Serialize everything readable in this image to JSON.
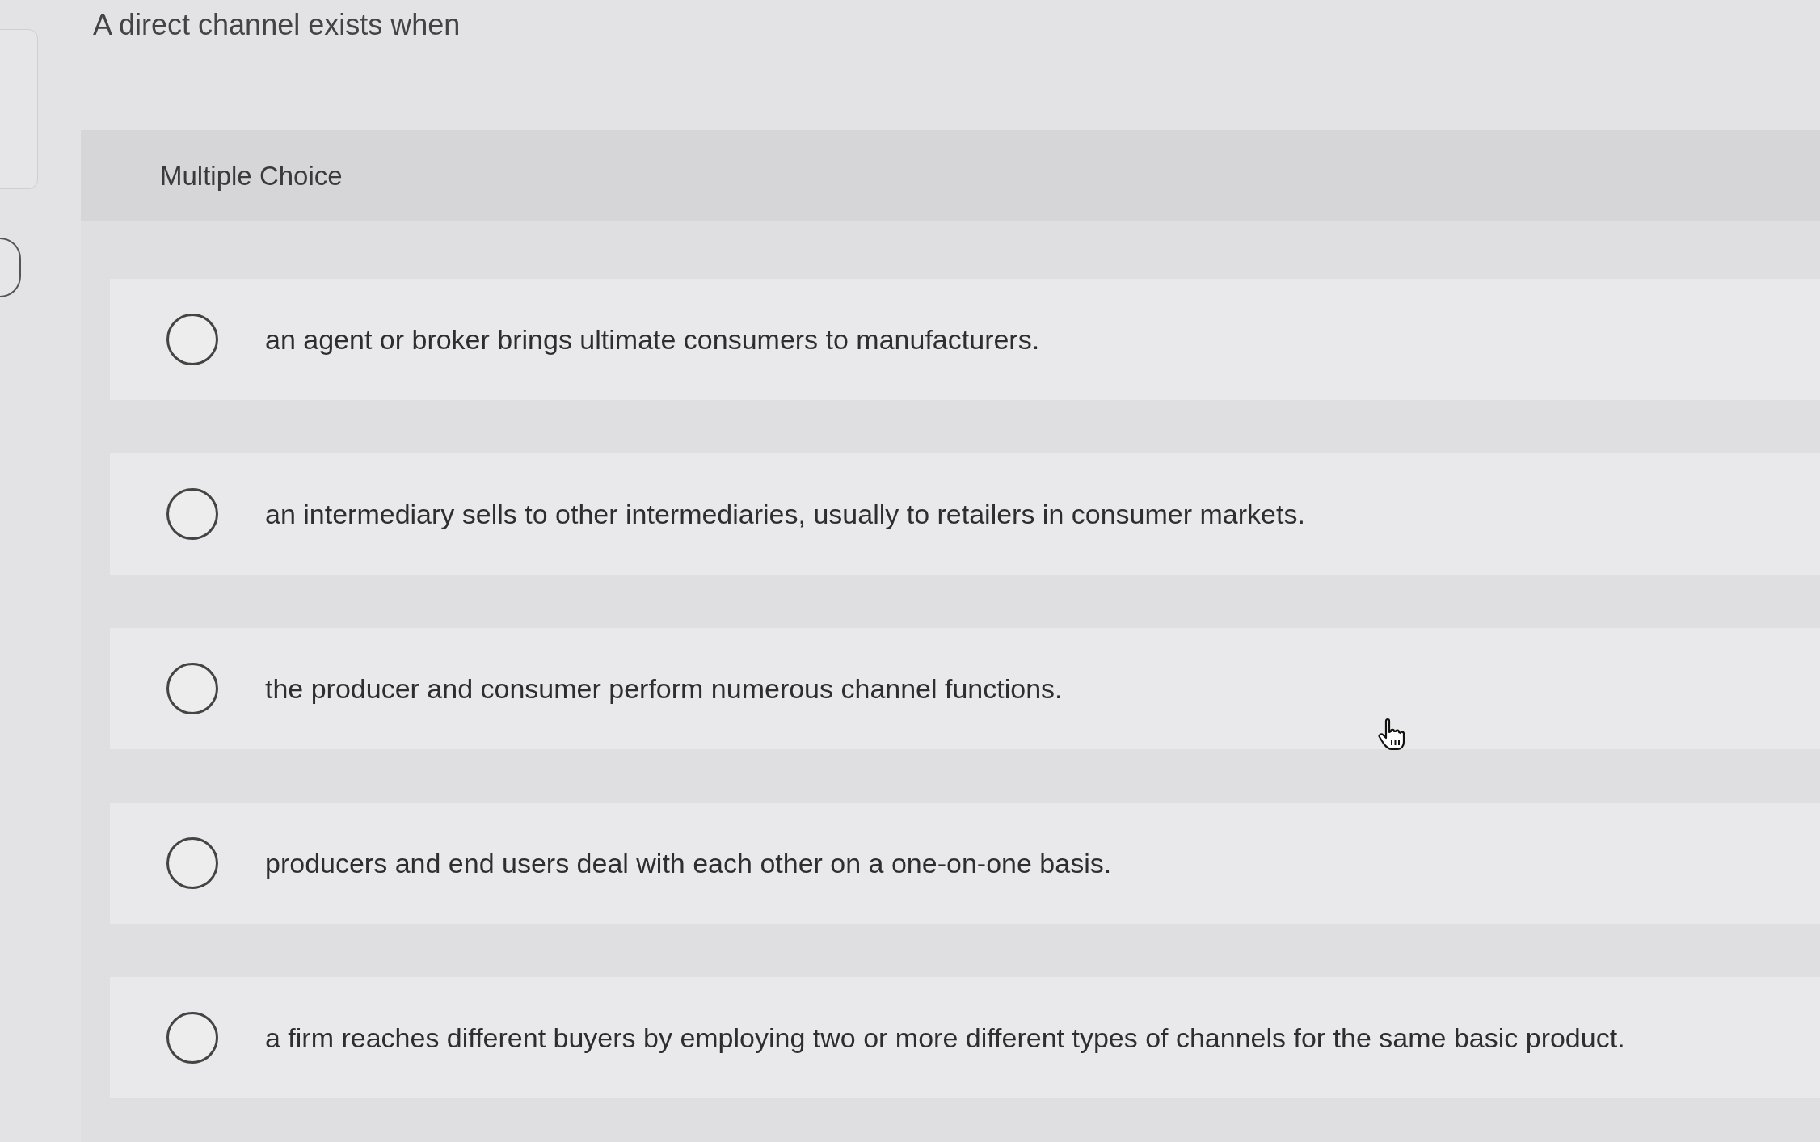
{
  "question": {
    "prompt": "A direct channel exists when"
  },
  "panel": {
    "label": "Multiple Choice"
  },
  "options": [
    {
      "text": "an agent or broker brings ultimate consumers to manufacturers.",
      "selected": false
    },
    {
      "text": "an intermediary sells to other intermediaries, usually to retailers in consumer markets.",
      "selected": false
    },
    {
      "text": "the producer and consumer perform numerous channel functions.",
      "selected": false
    },
    {
      "text": "producers and end users deal with each other on a one-on-one basis.",
      "selected": false
    },
    {
      "text": "a firm reaches different buyers by employing two or more different types of channels for the same basic product.",
      "selected": false
    }
  ]
}
